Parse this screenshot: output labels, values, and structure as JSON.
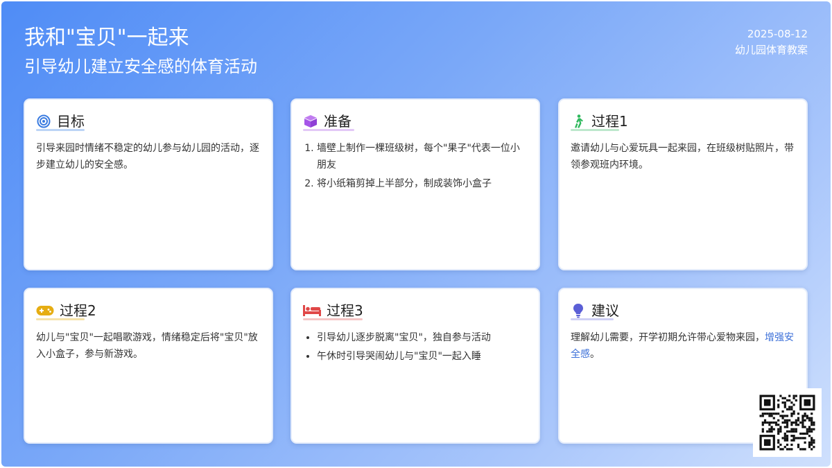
{
  "header": {
    "title": "我和\"宝贝\"一起来",
    "subtitle": "引导幼儿建立安全感的体育活动",
    "date": "2025-08-12",
    "category": "幼儿园体育教案"
  },
  "cards": [
    {
      "title": "目标",
      "icon": "target-icon",
      "color": "#3a7be0",
      "text": "引导来园时情绪不稳定的幼儿参与幼儿园的活动，逐步建立幼儿的安全感。"
    },
    {
      "title": "准备",
      "icon": "box-icon",
      "color": "#a555e8",
      "items": [
        "墙壁上制作一棵班级树，每个\"果子\"代表一位小朋友",
        "将小纸箱剪掉上半部分，制成装饰小盒子"
      ]
    },
    {
      "title": "过程1",
      "icon": "walking-icon",
      "color": "#2eb85c",
      "text": "邀请幼儿与心爱玩具一起来园，在班级树贴照片，带领参观班内环境。"
    },
    {
      "title": "过程2",
      "icon": "gamepad-icon",
      "color": "#e6ad12",
      "text": "幼儿与\"宝贝\"一起唱歌游戏，情绪稳定后将\"宝贝\"放入小盒子，参与新游戏。"
    },
    {
      "title": "过程3",
      "icon": "bed-icon",
      "color": "#e04848",
      "items": [
        "引导幼儿逐步脱离\"宝贝\"，独自参与活动",
        "午休时引导哭闹幼儿与\"宝贝\"一起入睡"
      ]
    },
    {
      "title": "建议",
      "icon": "lightbulb-icon",
      "color": "#5b5fd6",
      "text_plain": "理解幼儿需要，开学初期允许带心爱物来园，",
      "text_highlight": "增强安全感",
      "text_end": "。"
    }
  ]
}
